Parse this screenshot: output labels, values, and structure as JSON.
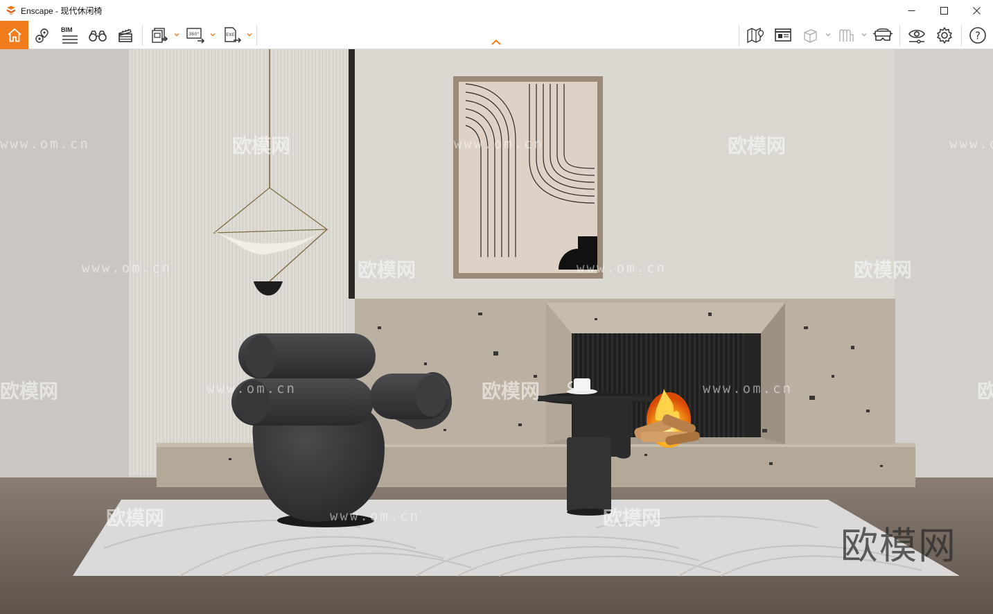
{
  "window": {
    "title": "Enscape - 现代休闲椅",
    "controls": [
      "minimize",
      "maximize",
      "close"
    ]
  },
  "toolbar": {
    "left": [
      {
        "id": "home",
        "icon": "home-icon"
      },
      {
        "id": "views",
        "icon": "map-pin-view-icon"
      },
      {
        "id": "bim",
        "icon": "bim-icon",
        "label": "BIM"
      },
      {
        "id": "walk",
        "icon": "binoculars-icon"
      },
      {
        "id": "video",
        "icon": "clapperboard-icon"
      },
      {
        "id": "batch",
        "icon": "batch-export-icon"
      },
      {
        "id": "pano",
        "icon": "panorama-360-icon",
        "label": "360°"
      },
      {
        "id": "exe",
        "icon": "exe-export-icon",
        "label": "EXE"
      }
    ],
    "right": [
      {
        "id": "minimap",
        "icon": "map-icon"
      },
      {
        "id": "info",
        "icon": "info-panel-icon"
      },
      {
        "id": "asset",
        "icon": "cube-icon"
      },
      {
        "id": "material",
        "icon": "material-icon"
      },
      {
        "id": "vr",
        "icon": "vr-headset-icon"
      },
      {
        "id": "visual",
        "icon": "eye-settings-icon"
      },
      {
        "id": "settings",
        "icon": "gear-icon"
      },
      {
        "id": "help",
        "icon": "help-icon",
        "label": "?"
      }
    ],
    "collapse_icon": "chevron-up-icon"
  },
  "colors": {
    "accent": "#f07c1c",
    "wall": "#d7d3ce",
    "stone": "#b8ae9f",
    "floor": "#75695f",
    "chair": "#3a3a3c",
    "rug": "#dcdad8"
  },
  "watermarks": {
    "url_text": "www.om.cn",
    "brand_text": "欧模网",
    "big_text": "欧模网"
  }
}
